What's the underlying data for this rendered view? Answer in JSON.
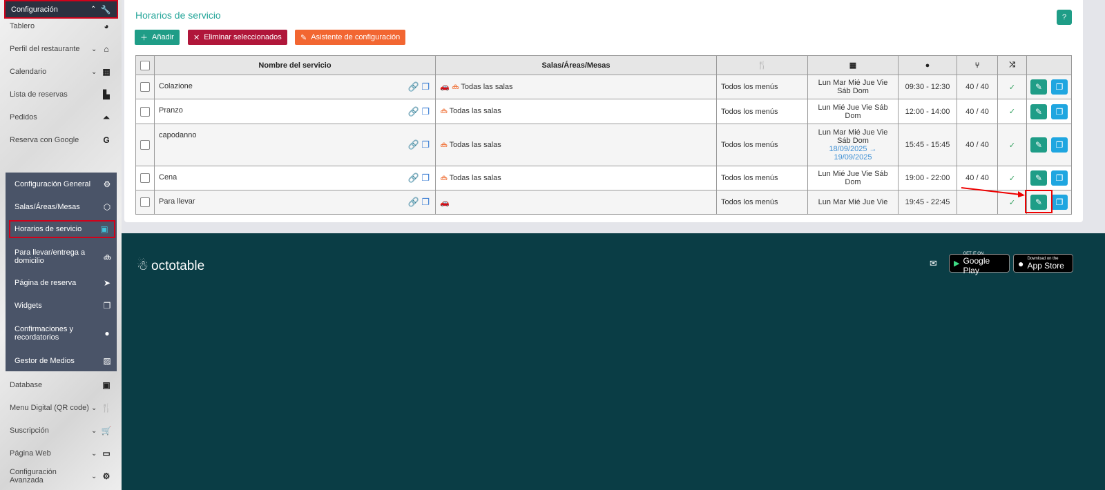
{
  "sidebar": {
    "items": [
      {
        "label": "Tablero",
        "icon": "dashboard-icon",
        "chev": false
      },
      {
        "label": "Perfil del restaurante",
        "icon": "home-icon",
        "chev": true
      },
      {
        "label": "Calendario",
        "icon": "calendar-icon",
        "chev": true
      },
      {
        "label": "Lista de reservas",
        "icon": "book-icon",
        "chev": false
      },
      {
        "label": "Pedidos",
        "icon": "bell-icon",
        "chev": false
      },
      {
        "label": "Reserva con Google",
        "icon": "google-icon",
        "chev": false
      }
    ],
    "config": {
      "label": "Configuración",
      "icon": "wrench-icon"
    },
    "sub": [
      {
        "label": "Configuración General",
        "icon": "gear-icon"
      },
      {
        "label": "Salas/Áreas/Mesas",
        "icon": "cube-icon"
      },
      {
        "label": "Horarios de servicio",
        "icon": "calendar-check-icon"
      },
      {
        "label": "Para llevar/entrega a domicilio",
        "icon": "bicycle-icon"
      },
      {
        "label": "Página de reserva",
        "icon": "pointer-icon"
      },
      {
        "label": "Widgets",
        "icon": "windows-icon"
      },
      {
        "label": "Confirmaciones y recordatorios",
        "icon": "chat-icon"
      },
      {
        "label": "Gestor de Medios",
        "icon": "image-icon"
      }
    ],
    "bottom": [
      {
        "label": "Database",
        "icon": "contact-icon"
      },
      {
        "label": "Menu Digital (QR code)",
        "icon": "utensils-icon"
      },
      {
        "label": "Suscripción",
        "icon": "cart-icon"
      },
      {
        "label": "Página Web",
        "icon": "monitor-icon"
      },
      {
        "label": "Configuración Avanzada",
        "icon": "gears-icon"
      }
    ]
  },
  "page": {
    "title": "Horarios de servicio",
    "help": "?",
    "add": "Añadir",
    "delete": "Eliminar seleccionados",
    "wizard": "Asistente de configuración"
  },
  "colors": {
    "accent": "#26a69a",
    "danger": "#b0163a",
    "orange": "#f26631",
    "footer": "#0a3d45"
  },
  "table": {
    "headers": {
      "name": "Nombre del servicio",
      "salas": "Salas/Áreas/Mesas"
    },
    "rows": [
      {
        "name": "Colazione",
        "salas": "Todas las salas",
        "car": true,
        "bike": true,
        "menus": "Todos los menús",
        "days": "Lun Mar Mié Jue Vie Sáb Dom",
        "dates": "",
        "time": "09:30 - 12:30",
        "cap": "40 / 40"
      },
      {
        "name": "Pranzo",
        "salas": "Todas las salas",
        "car": false,
        "bike": true,
        "menus": "Todos los menús",
        "days": "Lun Mié Jue Vie Sáb Dom",
        "dates": "",
        "time": "12:00 - 14:00",
        "cap": "40 / 40"
      },
      {
        "name": "capodanno",
        "salas": "Todas las salas",
        "car": false,
        "bike": true,
        "menus": "Todos los menús",
        "days": "Lun Mar Mié Jue Vie Sáb Dom",
        "dates": "18/09/2025 → 19/09/2025",
        "time": "15:45 - 15:45",
        "cap": "40 / 40"
      },
      {
        "name": "Cena",
        "salas": "Todas las salas",
        "car": false,
        "bike": true,
        "menus": "Todos los menús",
        "days": "Lun Mié Jue Vie Sáb Dom",
        "dates": "",
        "time": "19:00 - 22:00",
        "cap": "40 / 40"
      },
      {
        "name": "Para llevar",
        "salas": "",
        "car": true,
        "bike": false,
        "menus": "Todos los menús",
        "days": "Lun Mar Mié Jue Vie",
        "dates": "",
        "time": "19:45 - 22:45",
        "cap": ""
      }
    ]
  },
  "footer": {
    "logo": "octotable",
    "gplay_small": "GET IT ON",
    "gplay": "Google Play",
    "appstore_small": "Download on the",
    "appstore": "App Store"
  }
}
